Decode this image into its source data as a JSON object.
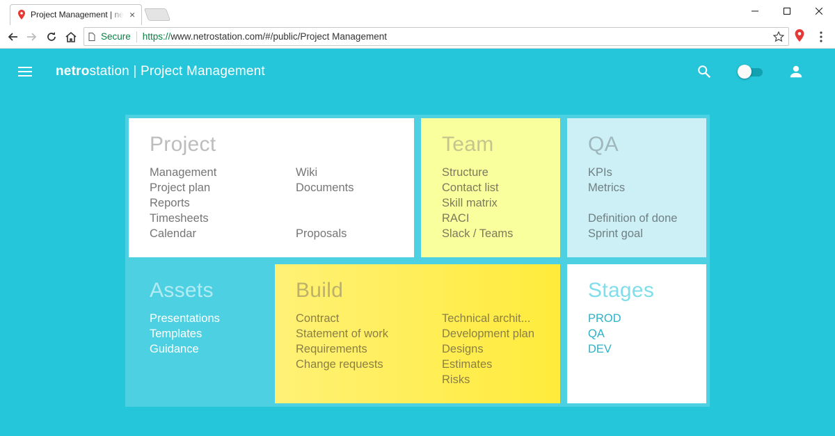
{
  "browser": {
    "tab_title": "Project Management | netrostation",
    "tab_close": "×",
    "secure_label": "Secure",
    "url_scheme": "https://",
    "url_rest": "www.netrostation.com/#/public/Project Management"
  },
  "app": {
    "brand_bold": "netro",
    "brand_light": "station",
    "brand_rest": " | Project Management",
    "toggle_on": false,
    "accent": "#26c6da"
  },
  "cards": {
    "project": {
      "title": "Project",
      "left": [
        "Management",
        "Project plan",
        "Reports",
        "Timesheets",
        "Calendar"
      ],
      "right": [
        "Wiki",
        "Documents",
        "",
        "",
        "Proposals"
      ]
    },
    "team": {
      "title": "Team",
      "items": [
        "Structure",
        "Contact list",
        "Skill matrix",
        "RACI",
        "Slack / Teams"
      ]
    },
    "qa": {
      "title": "QA",
      "items": [
        "KPIs",
        "Metrics",
        "",
        "Definition of done",
        "Sprint goal"
      ]
    },
    "assets": {
      "title": "Assets",
      "items": [
        "Presentations",
        "Templates",
        "Guidance"
      ]
    },
    "build": {
      "title": "Build",
      "left": [
        "Contract",
        "Statement of work",
        "Requirements",
        "Change requests"
      ],
      "right": [
        "Technical archit...",
        "Development plan",
        "Designs",
        "Estimates",
        "Risks"
      ]
    },
    "stages": {
      "title": "Stages",
      "items": [
        "PROD",
        "QA",
        "DEV"
      ]
    }
  }
}
